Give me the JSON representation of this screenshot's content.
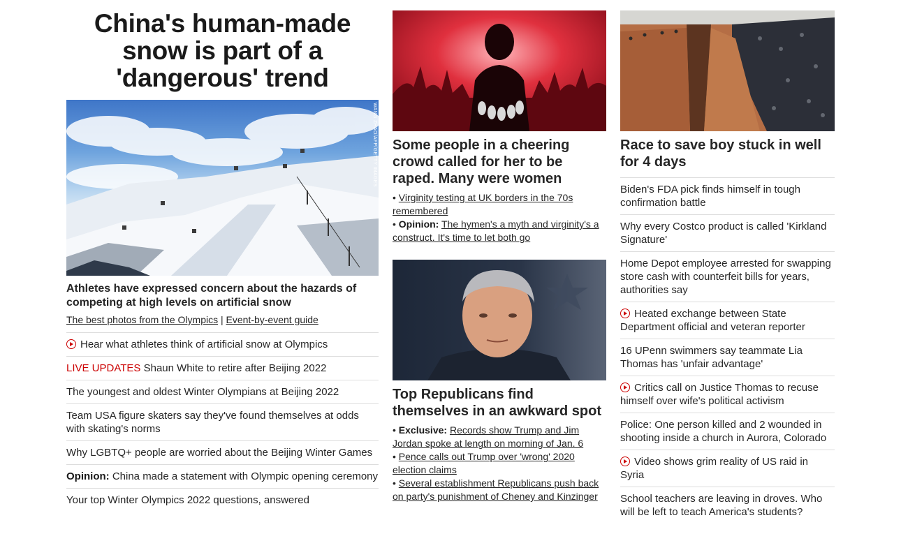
{
  "left": {
    "headline": "China's human-made snow is part of a 'dangerous' trend",
    "image_credit": "WANG ZHAO/AFP/GETTY IMAGES",
    "subheadline": "Athletes have expressed concern about the hazards of competing at high levels on artificial snow",
    "link1": "The best photos from the Olympics",
    "separator": "|",
    "link2": "Event-by-event guide",
    "items": [
      {
        "text": "Hear what athletes think of artificial snow at Olympics"
      },
      {
        "live": "LIVE UPDATES",
        "text": "Shaun White to retire after Beijing 2022"
      },
      {
        "text": "The youngest and oldest Winter Olympians at Beijing 2022"
      },
      {
        "text": "Team USA figure skaters say they've found themselves at odds with skating's norms"
      },
      {
        "text": "Why LGBTQ+ people are worried about the Beijing Winter Games"
      },
      {
        "label": "Opinion:",
        "text": "China made a statement with Olympic opening ceremony"
      },
      {
        "text": "Your top Winter Olympics 2022 questions, answered"
      }
    ]
  },
  "middle": {
    "card1": {
      "title": "Some people in a cheering crowd called for her to be raped. Many were women",
      "bullet1": "Virginity testing at UK borders in the 70s remembered",
      "bullet2_label": "Opinion:",
      "bullet2": "The hymen's a myth and virginity's a construct. It's time to let both go"
    },
    "card2": {
      "title": "Top Republicans find themselves in an awkward spot",
      "bullet1_label": "Exclusive:",
      "bullet1": "Records show Trump and Jim Jordan spoke at length on morning of Jan. 6",
      "bullet2": "Pence calls out Trump over 'wrong' 2020 election claims",
      "bullet3": "Several establishment Republicans push back on party's punishment of Cheney and Kinzinger"
    }
  },
  "right": {
    "title": "Race to save boy stuck in well for 4 days",
    "items": [
      {
        "text": "Biden's FDA pick finds himself in tough confirmation battle"
      },
      {
        "text": "Why every Costco product is called 'Kirkland Signature'"
      },
      {
        "text": "Home Depot employee arrested for swapping store cash with counterfeit bills for years, authorities say"
      },
      {
        "text": "Heated exchange between State Department official and veteran reporter"
      },
      {
        "text": "16 UPenn swimmers say teammate Lia Thomas has 'unfair advantage'"
      },
      {
        "text": "Critics call on Justice Thomas to recuse himself over wife's political activism"
      },
      {
        "text": "Police: One person killed and 2 wounded in shooting inside a church in Aurora, Colorado"
      },
      {
        "text": "Video shows grim reality of US raid in Syria"
      },
      {
        "text": "School teachers are leaving in droves. Who will be left to teach America's students?"
      }
    ]
  }
}
